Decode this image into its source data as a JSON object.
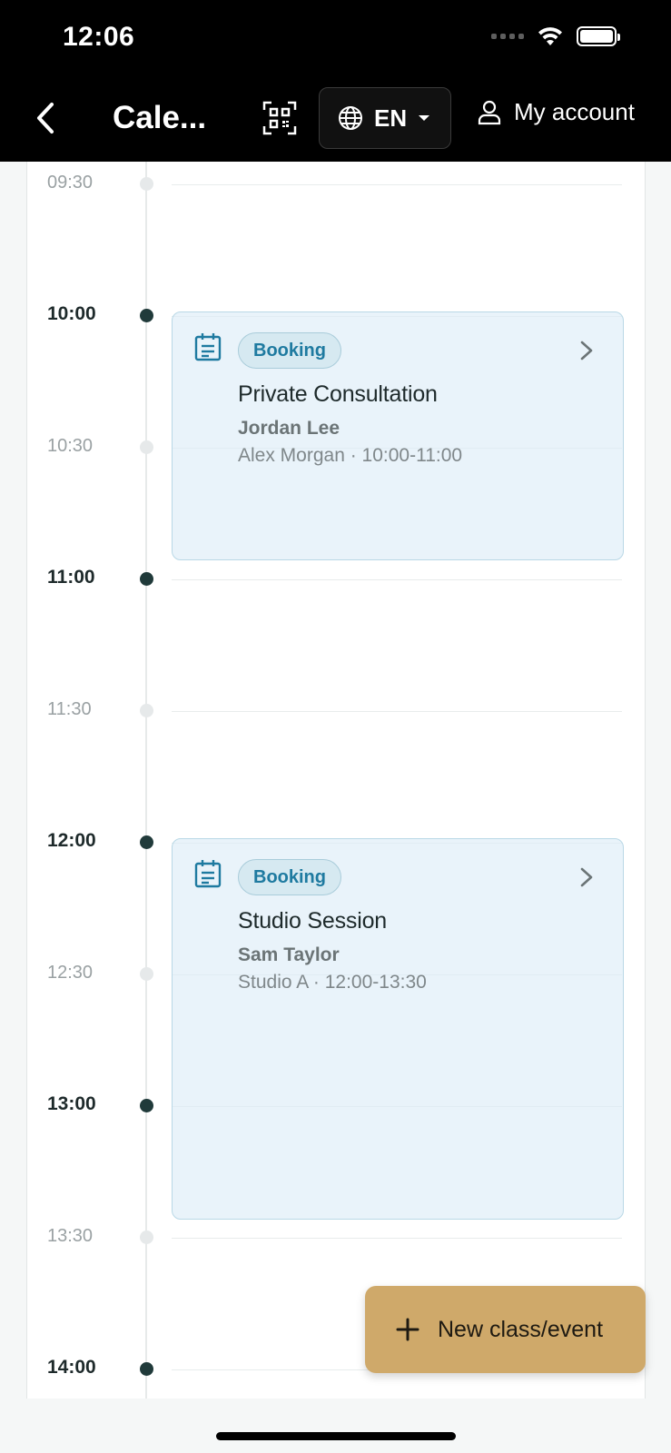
{
  "status_bar": {
    "time": "12:06"
  },
  "header": {
    "title": "Cale...",
    "language": "EN",
    "account_label": "My account"
  },
  "timeline": [
    {
      "time": "09:30",
      "hour": false
    },
    {
      "time": "10:00",
      "hour": true
    },
    {
      "time": "10:30",
      "hour": false
    },
    {
      "time": "11:00",
      "hour": true
    },
    {
      "time": "11:30",
      "hour": false
    },
    {
      "time": "12:00",
      "hour": true
    },
    {
      "time": "12:30",
      "hour": false
    },
    {
      "time": "13:00",
      "hour": true
    },
    {
      "time": "13:30",
      "hour": false
    },
    {
      "time": "14:00",
      "hour": true
    }
  ],
  "events": [
    {
      "badge": "Booking",
      "title": "Private Consultation",
      "person": "Jordan Lee",
      "meta": "Alex Morgan · 10:00-11:00"
    },
    {
      "badge": "Booking",
      "title": "Studio Session",
      "person": "Sam Taylor",
      "meta": "Studio A · 12:00-13:30"
    }
  ],
  "fab": {
    "label": "New class/event"
  },
  "colors": {
    "header_bg": "#000000",
    "accent_gold": "#cfa96a",
    "badge_text": "#1e7aa0",
    "event_bg": "#ddecf7"
  }
}
